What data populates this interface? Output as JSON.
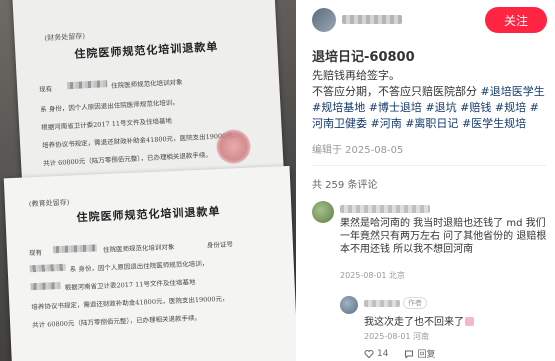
{
  "post": {
    "follow_label": "关注",
    "title": "退培日记-60800",
    "body_line1": "先赔钱再给签字。",
    "body_line2": "不答应分期，不答应只赔医院部分",
    "tags": [
      "#退培医学生",
      "#规培基地",
      "#博士退培",
      "#退坑",
      "#赔钱",
      "#规培",
      "#河南卫健委",
      "#河南",
      "#离职日记",
      "#医学生规培"
    ],
    "date": "编辑于 2025-08-05"
  },
  "comments": {
    "count_label": "共 259 条评论",
    "items": [
      {
        "text": "果然是哈河南的 我当时退赔也还钱了 md 我们一年竟然只有两万左右 问了其他省份的 退赔根本不用还钱 所以我不想回河南",
        "meta": "2025-08-01 北京",
        "reply": {
          "badge": "作者",
          "text": "我这次走了也不回来了",
          "meta": "2025-08-01 河南",
          "like_count": "14",
          "reply_label": "回复"
        }
      }
    ]
  },
  "document": {
    "top_tag": "(财务处留存)",
    "title": "住院医师规范化培训退款单",
    "bottom_tag": "(教育处留存)",
    "line_a": "根据河南省卫计委2017 11号文件及住培基地",
    "line_b": "培养协议书规定，需退还财政补助金41800元，医院支出19000元，",
    "line_c": "共计 60800元（陆万零捌佰元整），已办理相关退款手续。",
    "line_d": "现有",
    "line_e": "住院医师规范化培训对象",
    "line_f": "身份证号",
    "line_g": "系   身份，因个人原因退出住院医师规范化培训，"
  },
  "colors": {
    "accent": "#ff2442",
    "tag": "#13386c",
    "meta": "#999999"
  },
  "icons": [
    "heart-icon",
    "comment-icon"
  ]
}
